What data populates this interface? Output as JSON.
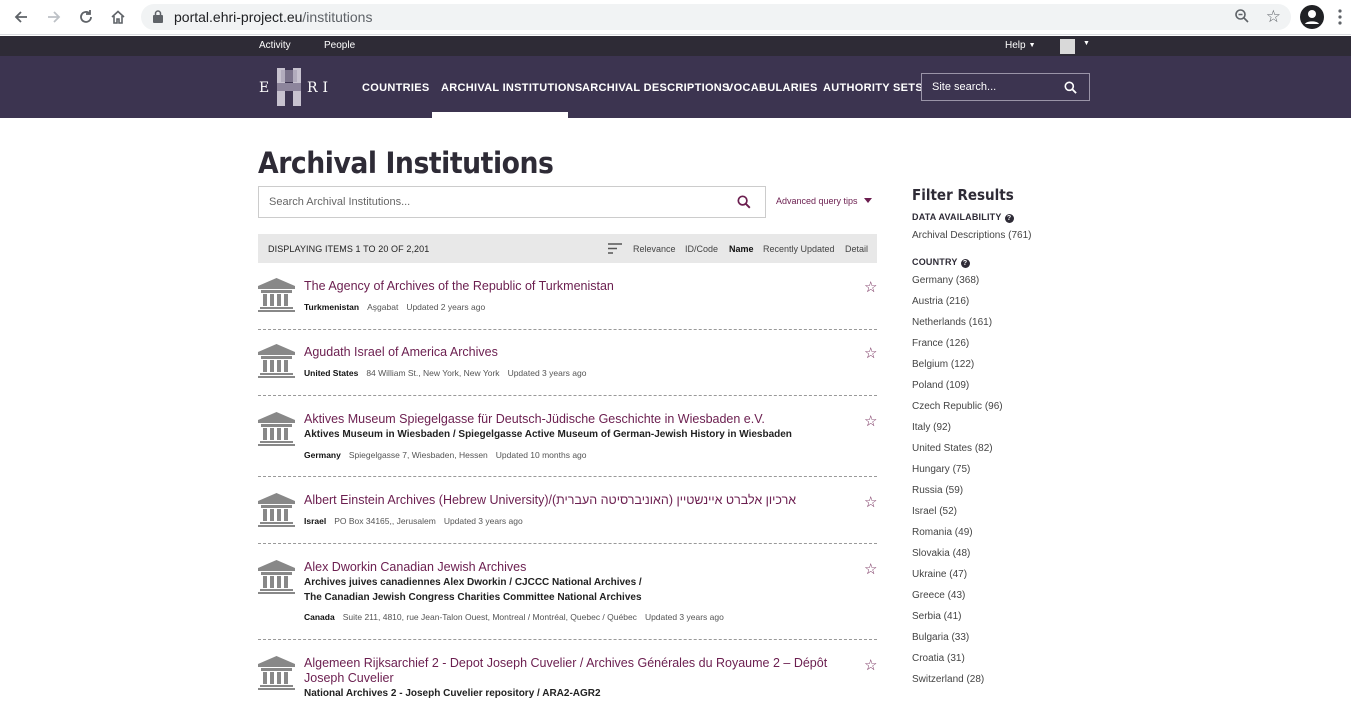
{
  "browser": {
    "url_host": "portal.ehri-project.eu",
    "url_path": "/institutions"
  },
  "topbar": {
    "links": [
      "Activity",
      "People"
    ],
    "help_label": "Help"
  },
  "nav": {
    "logo_text": "EHRI",
    "links": [
      "COUNTRIES",
      "ARCHIVAL INSTITUTIONS",
      "ARCHIVAL DESCRIPTIONS",
      "VOCABULARIES",
      "AUTHORITY SETS"
    ],
    "active": "ARCHIVAL INSTITUTIONS",
    "search_placeholder": "Site search..."
  },
  "page": {
    "title": "Archival Institutions",
    "search_placeholder": "Search Archival Institutions...",
    "advanced_tips": "Advanced query tips",
    "results_count": "DISPLAYING ITEMS 1 TO 20 OF 2,201",
    "sort_options": [
      "Relevance",
      "ID/Code",
      "Name",
      "Recently Updated",
      "Detail"
    ],
    "sort_selected": "Name"
  },
  "results": [
    {
      "title": "The Agency of Archives of the Republic of Turkmenistan",
      "alt_names": [],
      "country": "Turkmenistan",
      "address": "Aşgabat",
      "updated": "Updated 2 years ago"
    },
    {
      "title": "Agudath Israel of America Archives",
      "alt_names": [],
      "country": "United States",
      "address": "84 William St., New York, New York",
      "updated": "Updated 3 years ago"
    },
    {
      "title": "Aktives Museum Spiegelgasse für Deutsch-Jüdische Geschichte in Wiesbaden e.V.",
      "alt_names": [
        "Aktives Museum in Wiesbaden / Spiegelgasse Active Museum of German-Jewish History in Wiesbaden"
      ],
      "country": "Germany",
      "address": "Spiegelgasse 7, Wiesbaden, Hessen",
      "updated": "Updated 10 months ago"
    },
    {
      "title": "Albert Einstein Archives (Hebrew University)/(האוניברסיטה העברית) ארכיון אלברט איינשטיין",
      "alt_names": [],
      "country": "Israel",
      "address": "PO Box 34165,, Jerusalem",
      "updated": "Updated 3 years ago"
    },
    {
      "title": "Alex Dworkin Canadian Jewish Archives",
      "alt_names": [
        "Archives juives canadiennes Alex Dworkin / CJCCC National Archives /",
        "The Canadian Jewish Congress Charities Committee National Archives"
      ],
      "country": "Canada",
      "address": "Suite 211, 4810, rue Jean-Talon Ouest, Montreal / Montréal, Quebec / Québec",
      "updated": "Updated 3 years ago"
    },
    {
      "title": "Algemeen Rijksarchief 2 - Depot Joseph Cuvelier / Archives Générales du Royaume 2 – Dépôt Joseph Cuvelier",
      "alt_names": [
        "National Archives 2 - Joseph Cuvelier repository / ARA2-AGR2"
      ],
      "country": "",
      "address": "",
      "updated": ""
    }
  ],
  "filters": {
    "heading": "Filter Results",
    "data_availability": {
      "title": "DATA AVAILABILITY",
      "items": [
        "Archival Descriptions (761)"
      ]
    },
    "country": {
      "title": "COUNTRY",
      "items": [
        "Germany (368)",
        "Austria (216)",
        "Netherlands (161)",
        "France (126)",
        "Belgium (122)",
        "Poland (109)",
        "Czech Republic (96)",
        "Italy (92)",
        "United States (82)",
        "Hungary (75)",
        "Russia (59)",
        "Israel (52)",
        "Romania (49)",
        "Slovakia (48)",
        "Ukraine (47)",
        "Greece (43)",
        "Serbia (41)",
        "Bulgaria (33)",
        "Croatia (31)",
        "Switzerland (28)"
      ]
    }
  },
  "colors": {
    "header_dark": "#2e2b36",
    "nav_bg": "#3c3450",
    "link": "#6b1e4f"
  }
}
